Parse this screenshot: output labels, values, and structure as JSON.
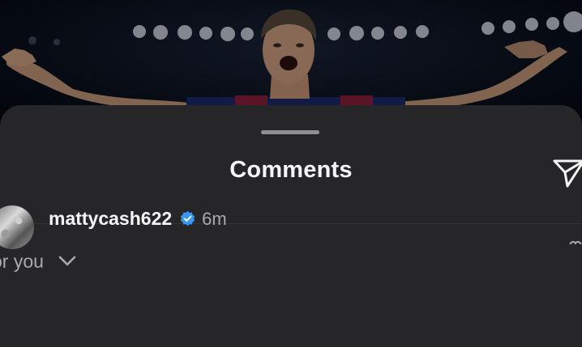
{
  "sheet": {
    "title": "Comments"
  },
  "sort": {
    "label": "or you"
  },
  "comments": [
    {
      "username": "mattycash622",
      "verified": true,
      "time": "6m"
    }
  ],
  "colors": {
    "sheet_bg": "#262629",
    "title_text": "#f5f5f5",
    "secondary_text": "#a9a9ae",
    "verified_badge": "#3897f0"
  },
  "icons": {
    "share": "paper-plane-icon",
    "sort": "chevron-down-icon",
    "verified": "verified-badge-icon"
  }
}
